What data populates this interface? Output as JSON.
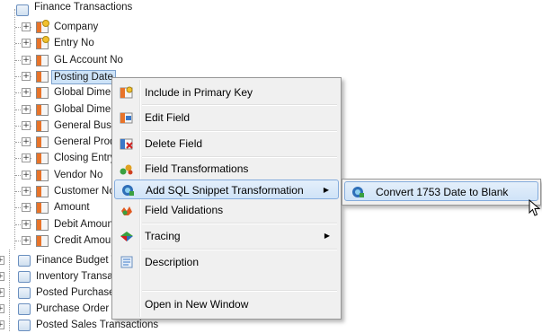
{
  "tree": {
    "root": {
      "label": "Finance Transactions"
    },
    "fields": [
      {
        "label": "Company",
        "key": true
      },
      {
        "label": "Entry No",
        "key": true
      },
      {
        "label": "GL Account No",
        "key": false
      },
      {
        "label": "Posting Date",
        "key": false,
        "selected": true
      },
      {
        "label": "Global Dimen",
        "key": false
      },
      {
        "label": "Global Dimen",
        "key": false
      },
      {
        "label": "General Busin",
        "key": false
      },
      {
        "label": "General Prod",
        "key": false
      },
      {
        "label": "Closing Entry",
        "key": false
      },
      {
        "label": "Vendor No",
        "key": false
      },
      {
        "label": "Customer No",
        "key": false
      },
      {
        "label": "Amount",
        "key": false
      },
      {
        "label": "Debit Amount",
        "key": false
      },
      {
        "label": "Credit Amoun",
        "key": false
      }
    ],
    "tables": [
      {
        "label": "Finance Budget T"
      },
      {
        "label": "Inventory Transa"
      },
      {
        "label": "Posted Purchase"
      },
      {
        "label": "Purchase Order T"
      },
      {
        "label": "Posted Sales Transactions"
      }
    ],
    "expander_glyph": "+"
  },
  "context_menu": {
    "items": [
      {
        "label": "Include in Primary Key",
        "icon": "primary-key-icon"
      },
      {
        "label": "Edit Field",
        "icon": "edit-field-icon"
      },
      {
        "label": "Delete Field",
        "icon": "delete-field-icon"
      },
      {
        "label": "Field Transformations",
        "icon": "field-transformations-icon"
      },
      {
        "label": "Add SQL Snippet Transformation",
        "icon": "sql-snippet-icon",
        "submenu": true,
        "highlighted": true
      },
      {
        "label": "Field Validations",
        "icon": "field-validations-icon"
      },
      {
        "label": "Tracing",
        "icon": "tracing-icon",
        "submenu": true
      },
      {
        "label": "Description",
        "icon": "description-icon"
      },
      {
        "label": "Open in New Window",
        "icon": ""
      }
    ],
    "submenu_arrow": "▶"
  },
  "submenu": {
    "items": [
      {
        "label": "Convert 1753 Date to Blank",
        "icon": "sql-snippet-icon",
        "highlighted": true
      }
    ]
  },
  "colors": {
    "selection_bg": "#cde3f8",
    "menu_highlight": "#cfe3f8",
    "field_icon_accent": "#e8742a"
  }
}
